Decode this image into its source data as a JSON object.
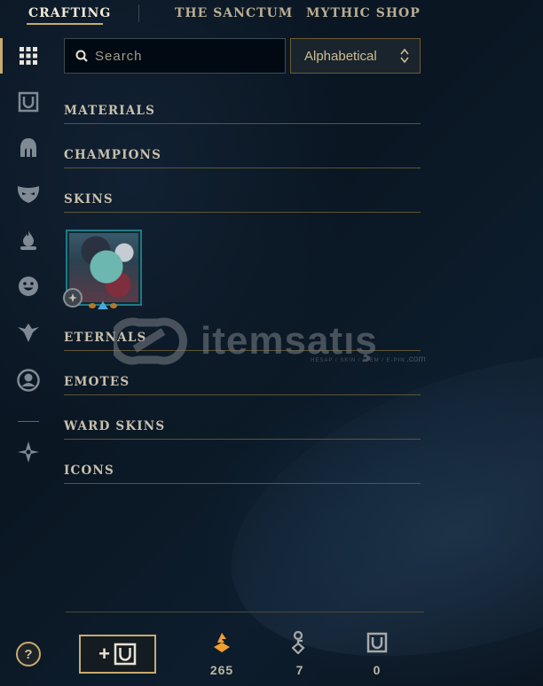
{
  "topnav": {
    "tabs": [
      {
        "label": "CRAFTING",
        "active": true
      },
      {
        "label": "THE SANCTUM",
        "active": false
      },
      {
        "label": "MYTHIC SHOP",
        "active": false
      }
    ]
  },
  "sidebar": {
    "items": [
      {
        "icon": "grid-icon",
        "active": true
      },
      {
        "icon": "chest-icon"
      },
      {
        "icon": "helmet-icon"
      },
      {
        "icon": "mask-icon"
      },
      {
        "icon": "flame-icon"
      },
      {
        "icon": "emote-face-icon"
      },
      {
        "icon": "ward-icon"
      },
      {
        "icon": "profile-icon"
      },
      {
        "icon": "compass-icon"
      }
    ]
  },
  "search": {
    "placeholder": "Search",
    "value": ""
  },
  "sort": {
    "selected": "Alphabetical"
  },
  "categories": [
    {
      "label": "MATERIALS"
    },
    {
      "label": "CHAMPIONS"
    },
    {
      "label": "SKINS"
    },
    {
      "label": "ETERNALS"
    },
    {
      "label": "EMOTES"
    },
    {
      "label": "WARD SKINS"
    },
    {
      "label": "ICONS"
    }
  ],
  "watermark": {
    "text": "itemsatış",
    "subtext": "HESAP / SKIN / ITEM / E-PIN",
    "suffix": ".com"
  },
  "bottom": {
    "help_label": "?",
    "currencies": [
      {
        "icon": "orange-essence-icon",
        "value": "265",
        "color": "#f0a030"
      },
      {
        "icon": "key-icon",
        "value": "7",
        "color": "#a8a8a8"
      },
      {
        "icon": "chest-icon",
        "value": "0",
        "color": "#a8a8a8"
      }
    ]
  },
  "colors": {
    "accent_gold": "#c8aa6e",
    "background": "#0a1420"
  }
}
